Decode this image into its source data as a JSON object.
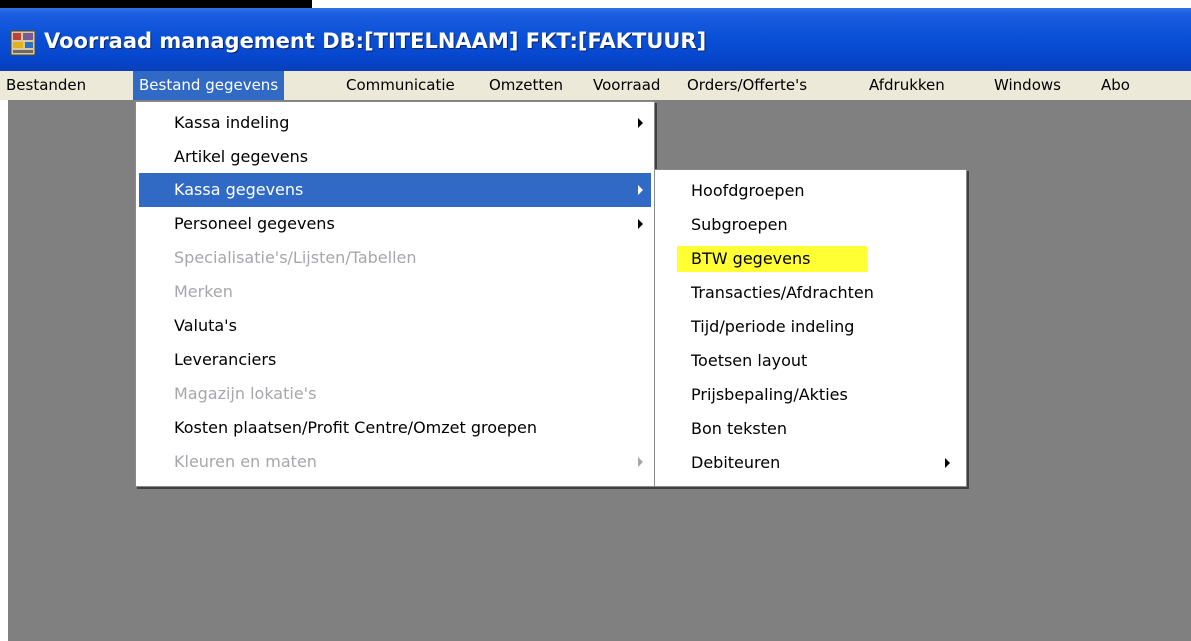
{
  "window": {
    "title": "Voorraad management DB:[TITELNAAM] FKT:[FAKTUUR]",
    "app_icon": "app-icon"
  },
  "menubar": {
    "items": [
      {
        "label": "Bestanden"
      },
      {
        "label": "Bestand gegevens",
        "active": true
      },
      {
        "label": "Communicatie"
      },
      {
        "label": "Omzetten"
      },
      {
        "label": "Voorraad"
      },
      {
        "label": "Orders/Offerte's"
      },
      {
        "label": "Afdrukken"
      },
      {
        "label": "Windows"
      },
      {
        "label": "Abo"
      }
    ]
  },
  "bestand_menu": {
    "items": [
      {
        "label": "Kassa indeling",
        "enabled": true,
        "submenu": true
      },
      {
        "label": "Artikel gegevens",
        "enabled": true,
        "submenu": false
      },
      {
        "label": "Kassa gegevens",
        "enabled": true,
        "submenu": true,
        "selected": true
      },
      {
        "label": "Personeel gegevens",
        "enabled": true,
        "submenu": true
      },
      {
        "label": "Specialisatie's/Lijsten/Tabellen",
        "enabled": false,
        "submenu": false
      },
      {
        "label": "Merken",
        "enabled": false,
        "submenu": false
      },
      {
        "label": "Valuta's",
        "enabled": true,
        "submenu": false
      },
      {
        "label": "Leveranciers",
        "enabled": true,
        "submenu": false
      },
      {
        "label": "Magazijn lokatie's",
        "enabled": false,
        "submenu": false
      },
      {
        "label": "Kosten plaatsen/Profit Centre/Omzet groepen",
        "enabled": true,
        "submenu": false
      },
      {
        "label": "Kleuren en maten",
        "enabled": false,
        "submenu": true
      }
    ]
  },
  "kassa_submenu": {
    "items": [
      {
        "label": "Hoofdgroepen",
        "submenu": false
      },
      {
        "label": "Subgroepen",
        "submenu": false
      },
      {
        "label": "BTW gegevens",
        "submenu": false,
        "highlighted": true
      },
      {
        "label": "Transacties/Afdrachten",
        "submenu": false
      },
      {
        "label": "Tijd/periode indeling",
        "submenu": false
      },
      {
        "label": "Toetsen layout",
        "submenu": false
      },
      {
        "label": "Prijsbepaling/Akties",
        "submenu": false
      },
      {
        "label": "Bon teksten",
        "submenu": false
      },
      {
        "label": "Debiteuren",
        "submenu": true
      }
    ],
    "highlight_color": "#ffff33"
  },
  "colors": {
    "titlebar": "#0a51d7",
    "menubar": "#ece9d8",
    "selection": "#316ac5",
    "workspace": "#808080",
    "disabled_text": "#a7a6aa"
  }
}
